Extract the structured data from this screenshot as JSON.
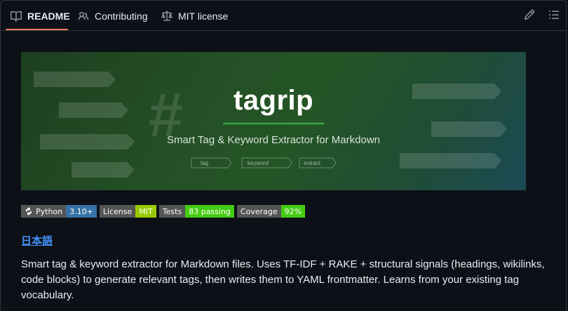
{
  "tabs": [
    {
      "label": "README",
      "icon": "book-icon",
      "active": true
    },
    {
      "label": "Contributing",
      "icon": "people-icon",
      "active": false
    },
    {
      "label": "MIT license",
      "icon": "law-icon",
      "active": false
    }
  ],
  "toolbar": {
    "edit_icon": "pencil-icon",
    "outline_icon": "list-icon"
  },
  "banner": {
    "title": "tagrip",
    "subtitle": "Smart Tag & Keyword Extractor for Markdown",
    "chips": [
      "tag",
      "keyword",
      "extract"
    ],
    "hash": "#"
  },
  "badges": [
    {
      "label": "Python",
      "value": "3.10+",
      "color": "#3572a5",
      "icon": "python-icon"
    },
    {
      "label": "License",
      "value": "MIT",
      "color": "#97ca00"
    },
    {
      "label": "Tests",
      "value": "83 passing",
      "color": "#4c1"
    },
    {
      "label": "Coverage",
      "value": "92%",
      "color": "#4c1"
    }
  ],
  "lang_link": "日本語",
  "description": "Smart tag & keyword extractor for Markdown files. Uses TF-IDF + RAKE + structural signals (headings, wikilinks, code blocks) to generate relevant tags, then writes them to YAML frontmatter. Learns from your existing tag vocabulary.",
  "colors": {
    "accent": "#f78166",
    "link": "#4493f8",
    "background": "#0d1117"
  }
}
